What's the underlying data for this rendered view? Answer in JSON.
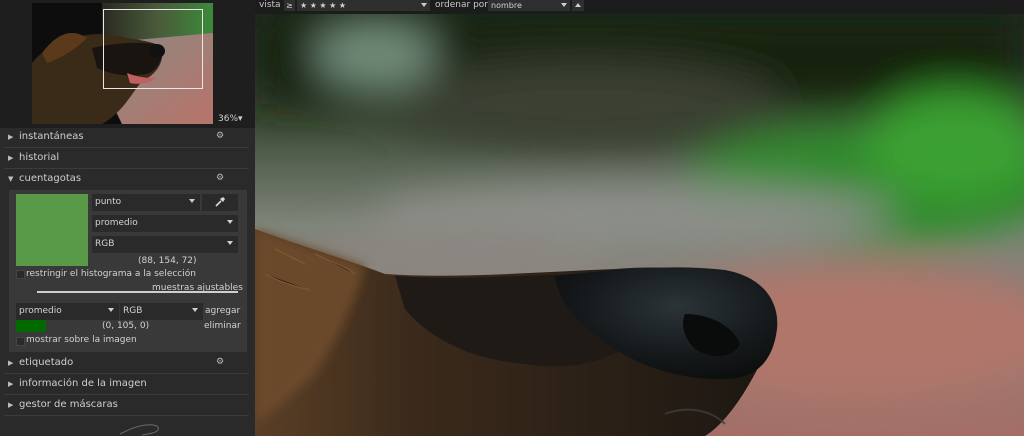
{
  "topbar": {
    "view_label": "vista",
    "comparator": "≥",
    "rating": "★ ★ ★ ★ ★",
    "sort_label": "ordenar por",
    "sort_value": "nombre"
  },
  "navigation": {
    "zoom": "36%▾"
  },
  "panels": {
    "snapshots": "instantáneas",
    "history": "historial",
    "colorpicker": "cuentagotas",
    "tagging": "etiquetado",
    "image_info": "información de la imagen",
    "mask_manager": "gestor de máscaras"
  },
  "colorpicker": {
    "mode": "punto",
    "statistic": "promedio",
    "color_model": "RGB",
    "readout": "(88, 154, 72)",
    "swatch_color": "#589a48",
    "restrict_label": "restringir el histograma a la selección",
    "samples_label": "muestras ajustables",
    "sample_statistic": "promedio",
    "sample_model": "RGB",
    "add_label": "agregar",
    "sample_readout": "(0, 105, 0)",
    "sample_swatch_color": "#006900",
    "remove_label": "eliminar",
    "overlay_label": "mostrar sobre la imagen"
  }
}
